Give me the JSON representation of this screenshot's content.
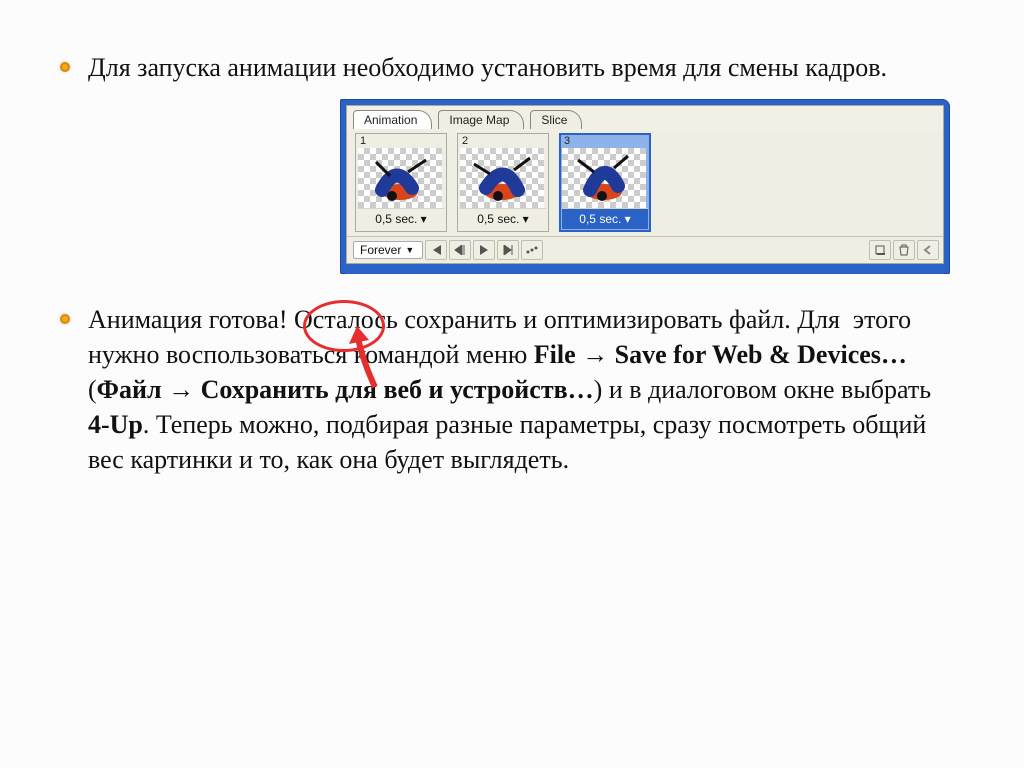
{
  "bullets": {
    "first": "Для запуска анимации необходимо установить время для смены кадров.",
    "second_lead": "Анимация готова! Осталось сохранить и оптимизировать файл. Для  этого нужно воспользоваться командой меню ",
    "menu_en": "File → Save for Web & Devices…",
    "paren_open": " (",
    "menu_ru": "Файл → Сохранить для веб и устройств…",
    "paren_close": ") ",
    "second_mid1": "и в диалоговом окне выбрать ",
    "option": "4-Up",
    "second_tail": ". Теперь можно, подбирая разные параметры, сразу посмотреть общий вес картинки и то, как она будет выглядеть."
  },
  "panel": {
    "tabs": {
      "animation": "Animation",
      "imagemap": "Image Map",
      "slice": "Slice"
    },
    "frames": [
      {
        "num": "1",
        "time": "0,5 sec."
      },
      {
        "num": "2",
        "time": "0,5 sec."
      },
      {
        "num": "3",
        "time": "0,5 sec."
      }
    ],
    "loop": "Forever"
  }
}
